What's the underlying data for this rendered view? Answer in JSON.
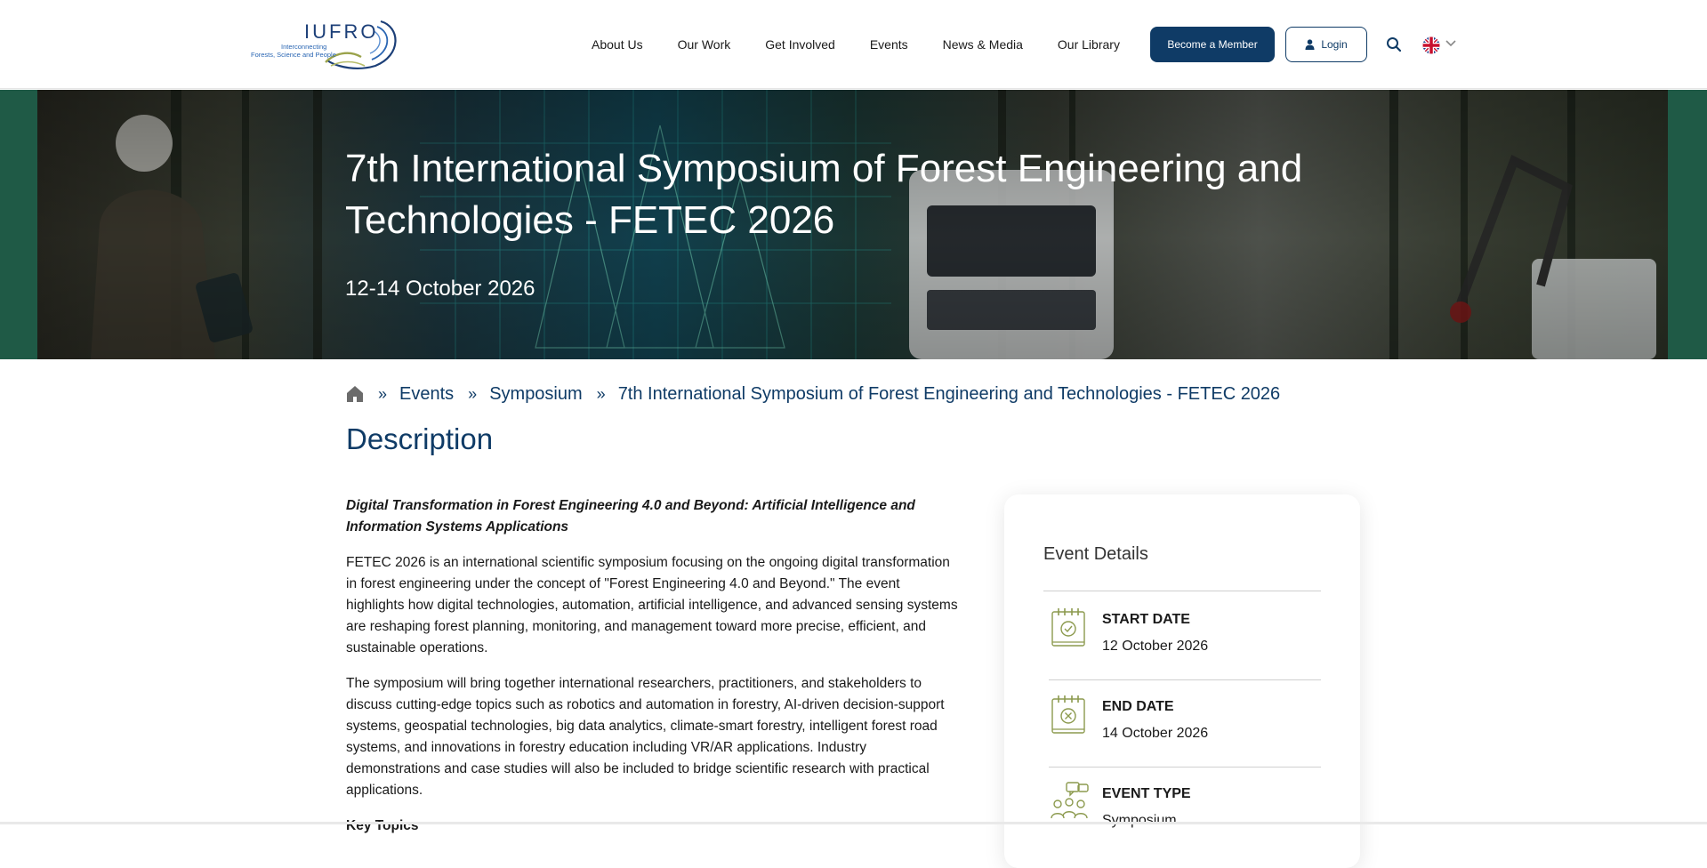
{
  "header": {
    "logo": {
      "name": "IUFRO",
      "tagline_1": "Interconnecting",
      "tagline_2": "Forests, Science and People"
    },
    "nav": [
      "About Us",
      "Our Work",
      "Get Involved",
      "Events",
      "News & Media",
      "Our Library"
    ],
    "member_button": "Become a Member",
    "login_button": "Login",
    "icons": [
      "user-icon",
      "search-icon",
      "uk-flag-icon",
      "chevron-down-icon"
    ],
    "colors": {
      "primary": "#0f3b66"
    }
  },
  "hero": {
    "title": "7th International Symposium of Forest Engineering and Technologies - FETEC 2026",
    "date": "12-14 October 2026"
  },
  "breadcrumb": {
    "home_icon": "home-icon",
    "items": [
      "Events",
      "Symposium",
      "7th International Symposium of Forest Engineering and Technologies - FETEC 2026"
    ]
  },
  "description": {
    "heading": "Description",
    "lead": "Digital Transformation in Forest Engineering 4.0 and Beyond: Artificial Intelligence and Information Systems Applications",
    "paragraphs": [
      "FETEC 2026 is an international scientific symposium focusing on the ongoing digital transformation in forest engineering under the concept of \"Forest Engineering 4.0 and Beyond.\" The event highlights how digital technologies, automation, artificial intelligence, and advanced sensing systems are reshaping forest planning, monitoring, and management toward more precise, efficient, and sustainable operations.",
      "The symposium will bring together international researchers, practitioners, and stakeholders to discuss cutting-edge topics such as robotics and automation in forestry, AI-driven decision-support systems, geospatial technologies, big data analytics, climate-smart forestry, intelligent forest road systems, and innovations in forestry education including VR/AR applications. Industry demonstrations and case studies will also be included to bridge scientific research with practical applications."
    ],
    "cut_heading": "Key Topics"
  },
  "event_details": {
    "title": "Event Details",
    "items": [
      {
        "label": "START DATE",
        "value": "12 October 2026",
        "icon": "calendar-check-icon"
      },
      {
        "label": "END DATE",
        "value": "14 October 2026",
        "icon": "calendar-x-icon"
      },
      {
        "label": "EVENT TYPE",
        "value": "Symposium",
        "icon": "people-chat-icon"
      }
    ]
  }
}
